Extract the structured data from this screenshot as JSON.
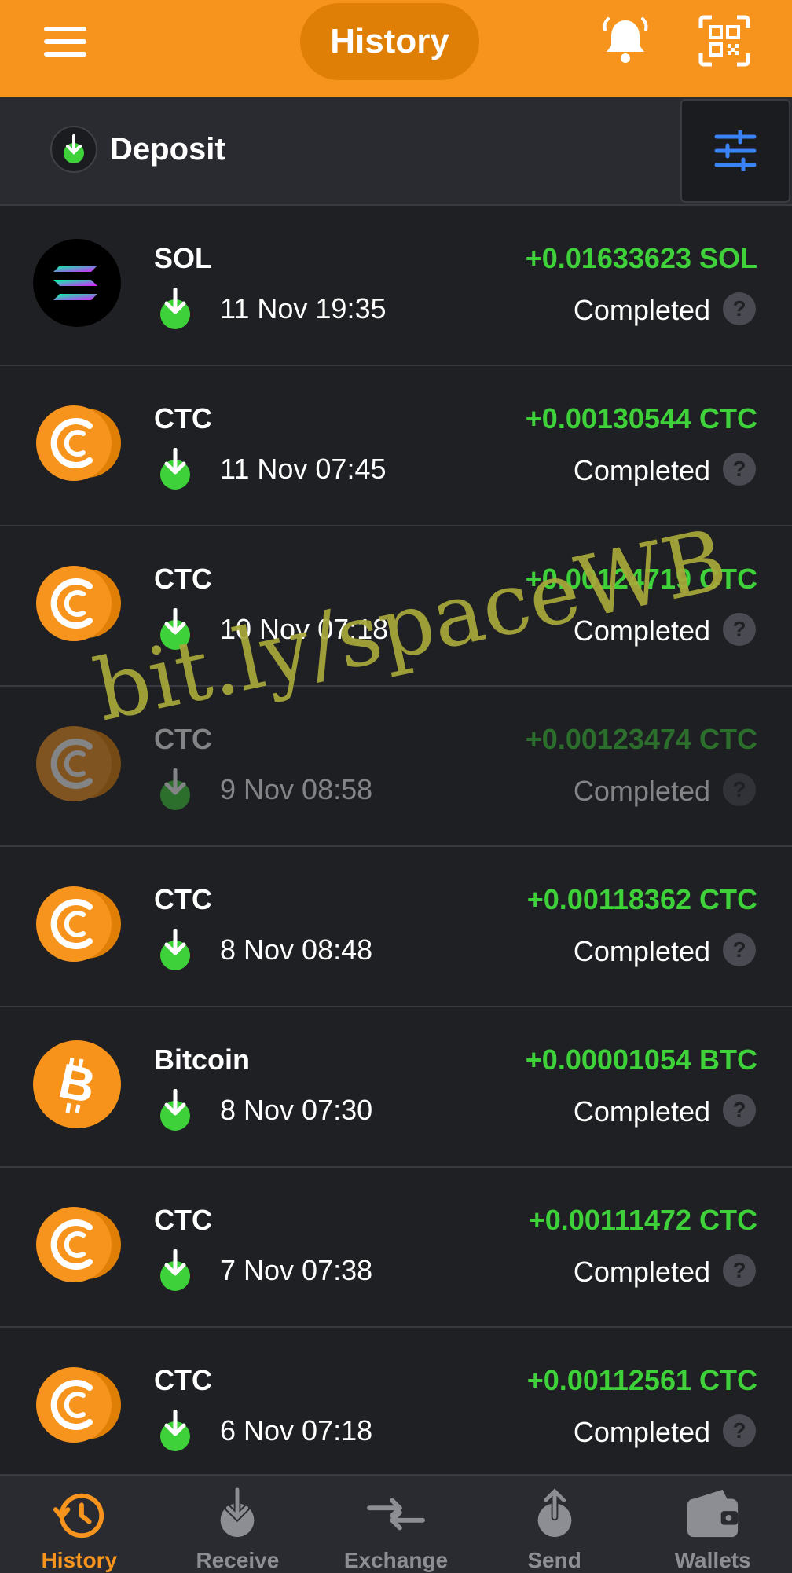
{
  "header": {
    "title": "History",
    "menu_icon": "hamburger-icon",
    "bell_icon": "bell-icon",
    "qr_icon": "qr-scan-icon",
    "accent": "#f7941d"
  },
  "filter": {
    "label": "Deposit",
    "icon": "deposit-arrow-icon",
    "filter_icon": "sliders-icon"
  },
  "transactions": [
    {
      "coin": "SOL",
      "logo": "solana-icon",
      "date": "11 Nov 19:35",
      "amount": "+0.01633623 SOL",
      "status": "Completed"
    },
    {
      "coin": "CTC",
      "logo": "ctc-icon",
      "date": "11 Nov 07:45",
      "amount": "+0.00130544 CTC",
      "status": "Completed"
    },
    {
      "coin": "CTC",
      "logo": "ctc-icon",
      "date": "10 Nov 07:18",
      "amount": "+0.00124719 CTC",
      "status": "Completed"
    },
    {
      "coin": "CTC",
      "logo": "ctc-icon",
      "date": "9 Nov 08:58",
      "amount": "+0.00123474 CTC",
      "status": "Completed"
    },
    {
      "coin": "CTC",
      "logo": "ctc-icon",
      "date": "8 Nov 08:48",
      "amount": "+0.00118362 CTC",
      "status": "Completed"
    },
    {
      "coin": "Bitcoin",
      "logo": "bitcoin-icon",
      "date": "8 Nov 07:30",
      "amount": "+0.00001054 BTC",
      "status": "Completed"
    },
    {
      "coin": "CTC",
      "logo": "ctc-icon",
      "date": "7 Nov 07:38",
      "amount": "+0.00111472 CTC",
      "status": "Completed"
    },
    {
      "coin": "CTC",
      "logo": "ctc-icon",
      "date": "6 Nov 07:18",
      "amount": "+0.00112561 CTC",
      "status": "Completed"
    }
  ],
  "help_glyph": "?",
  "watermark": "bit.ly/spaceWB",
  "nav": [
    {
      "label": "History",
      "icon": "history-icon",
      "active": true
    },
    {
      "label": "Receive",
      "icon": "receive-icon",
      "active": false
    },
    {
      "label": "Exchange",
      "icon": "exchange-icon",
      "active": false
    },
    {
      "label": "Send",
      "icon": "send-icon",
      "active": false
    },
    {
      "label": "Wallets",
      "icon": "wallet-icon",
      "active": false
    }
  ],
  "colors": {
    "positive": "#3ed13a",
    "ctc_orange": "#f7941d",
    "filter_blue": "#3b82f6"
  }
}
